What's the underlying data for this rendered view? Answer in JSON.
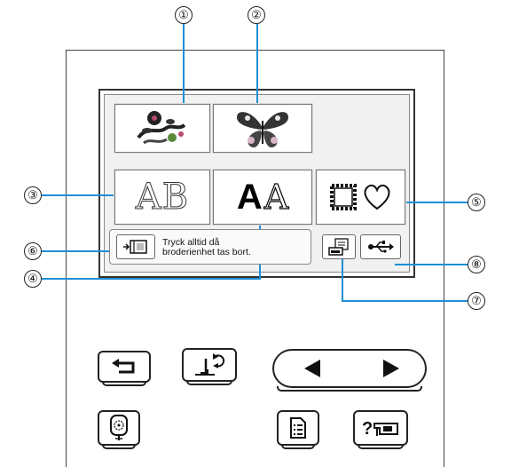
{
  "callouts": [
    "①",
    "②",
    "③",
    "④",
    "⑤",
    "⑥",
    "⑦",
    "⑧"
  ],
  "categories": {
    "floral_icon": "floral-embroidery-icon",
    "butterfly_icon": "butterfly-embroidery-icon",
    "alphabet_decorative": "AB",
    "alphabet_letters": {
      "bold": "A",
      "outline": "A"
    },
    "frame_heart": "frame-heart-icon"
  },
  "message": {
    "line1": "Tryck alltid då",
    "line2": "broderienhet tas bort."
  },
  "colors": {
    "callout_line": "#1e8fd6",
    "border": "#333333"
  }
}
